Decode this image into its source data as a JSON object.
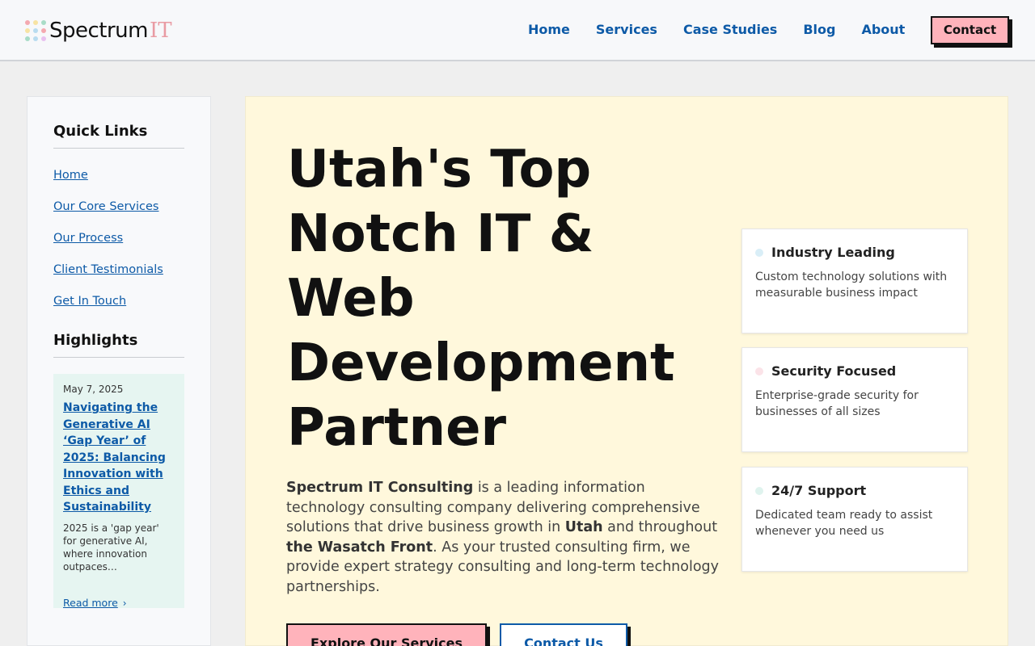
{
  "brand": {
    "name": "Spectrum",
    "suffix": "IT",
    "dot_colors": [
      "#f4a9b0",
      "#f7e3a3",
      "#a8dcc7",
      "#f7e3a3",
      "#b8dcf0",
      "#f4a9b0",
      "#a8dcc7",
      "#b8dcf0",
      "#e8c0f0"
    ]
  },
  "nav": {
    "items": [
      "Home",
      "Services",
      "Case Studies",
      "Blog",
      "About"
    ],
    "contact_label": "Contact"
  },
  "sidebar": {
    "quick_links_heading": "Quick Links",
    "links": [
      "Home",
      "Our Core Services",
      "Our Process",
      "Client Testimonials",
      "Get In Touch"
    ],
    "highlights_heading": "Highlights",
    "highlight": {
      "date": "May 7, 2025",
      "title": "Navigating the Generative AI ‘Gap Year’ of 2025: Balancing Innovation with Ethics and Sustainability",
      "excerpt": "2025 is a 'gap year' for generative AI, where innovation outpaces…",
      "read_more": "Read more",
      "read_more_icon": "chevron-right-icon"
    }
  },
  "hero": {
    "title": "Utah's Top Notch IT & Web Development Partner",
    "desc_parts": {
      "company": "Spectrum IT Consulting",
      "text1": " is a leading information technology consulting company delivering comprehensive solutions that drive business growth in ",
      "place1": "Utah",
      "text2": " and throughout ",
      "place2": "the Wasatch Front",
      "text3": ". As your trusted consulting firm, we provide expert strategy consulting and long-term technology partnerships."
    },
    "primary_button": "Explore Our Services",
    "secondary_button": "Contact Us"
  },
  "features": [
    {
      "title": "Industry Leading",
      "desc": "Custom technology solutions with measurable business impact",
      "dot_color": "#d9eef7"
    },
    {
      "title": "Security Focused",
      "desc": "Enterprise-grade security for businesses of all sizes",
      "dot_color": "#fbe3e8"
    },
    {
      "title": "24/7 Support",
      "desc": "Dedicated team ready to assist whenever you need us",
      "dot_color": "#dff3ee"
    }
  ]
}
